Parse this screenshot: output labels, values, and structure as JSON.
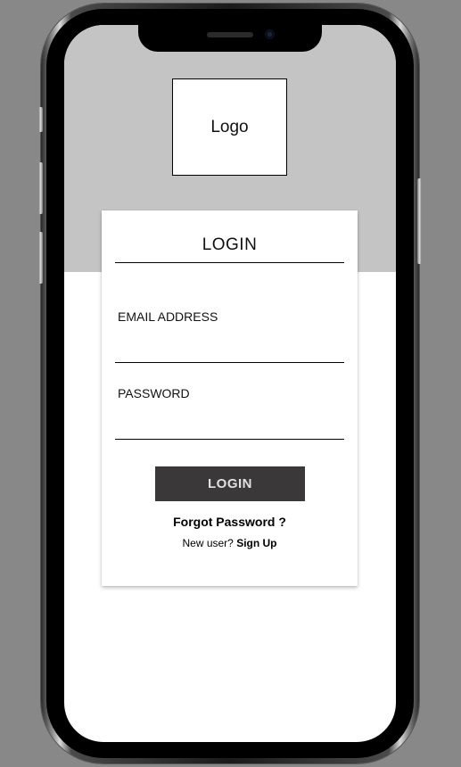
{
  "branding": {
    "logo_text": "Logo"
  },
  "login_card": {
    "title": "LOGIN",
    "email": {
      "label": "EMAIL ADDRESS",
      "value": "",
      "placeholder": ""
    },
    "password": {
      "label": "PASSWORD",
      "value": "",
      "placeholder": ""
    },
    "submit_label": "LOGIN",
    "forgot_label": "Forgot Password ?",
    "signup_prompt": "New user?",
    "signup_label": "Sign Up"
  },
  "colors": {
    "background": "#888888",
    "header_band": "#c4c4c4",
    "button": "#3a3838",
    "button_text": "#e0e0e0"
  }
}
